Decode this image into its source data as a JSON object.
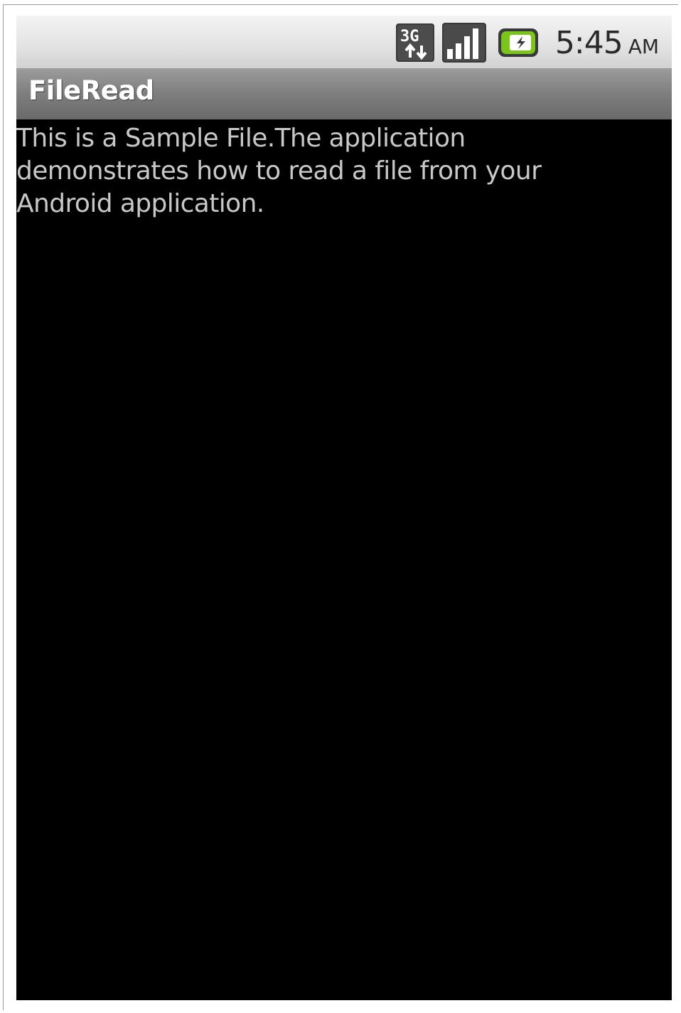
{
  "status_bar": {
    "network_icon": "3g-data-icon",
    "network_label": "3G",
    "signal_icon": "signal-strength-icon",
    "battery_icon": "battery-charging-icon",
    "battery_color": "#7ac41c",
    "time": "5:45",
    "ampm": "AM"
  },
  "app": {
    "title": "FileRead"
  },
  "content": {
    "text": "This is a Sample File.The application demonstrates how to read a file from your Android application."
  }
}
